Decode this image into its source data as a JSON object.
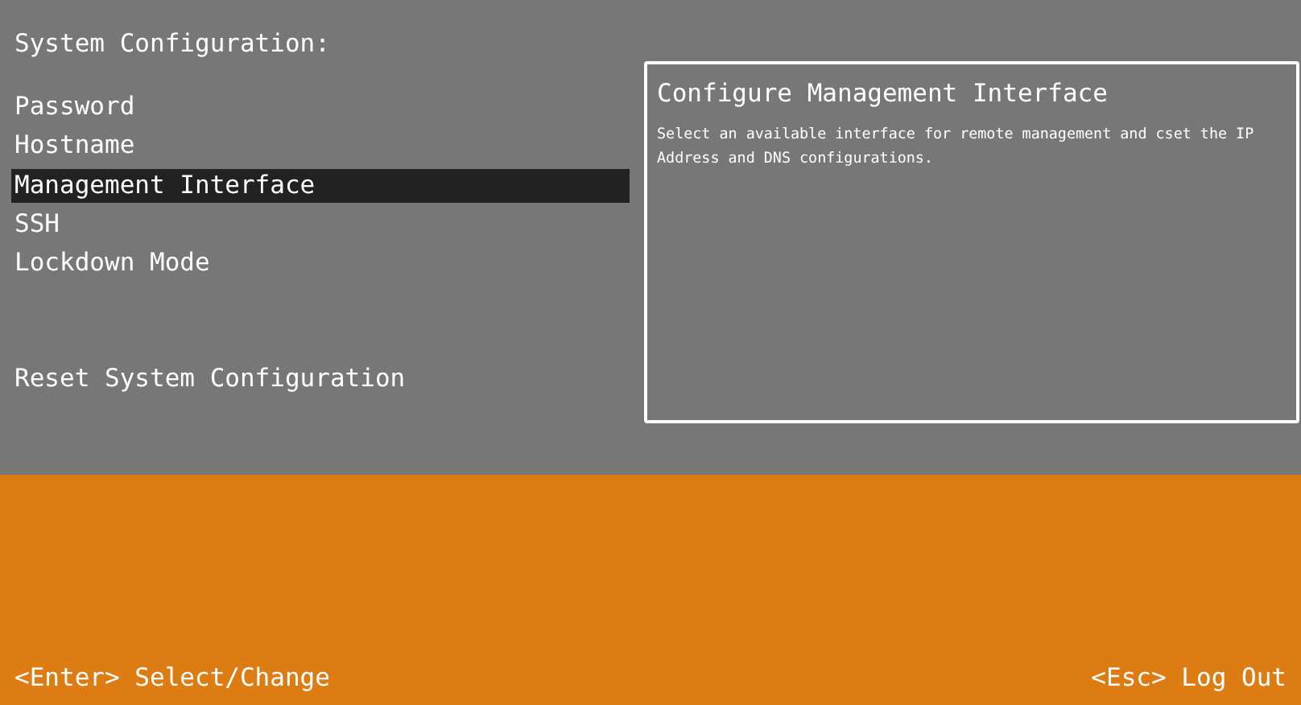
{
  "title": "System Configuration:",
  "menu": [
    {
      "label": "Password",
      "selected": false
    },
    {
      "label": "Hostname",
      "selected": false
    },
    {
      "label": "Management Interface",
      "selected": true
    },
    {
      "label": "SSH",
      "selected": false
    },
    {
      "label": "Lockdown Mode",
      "selected": false
    }
  ],
  "reset_item": {
    "label": "Reset System Configuration",
    "selected": false
  },
  "panel": {
    "title": "Configure Management Interface",
    "description": "Select an available interface for remote management and cset the IP Address and DNS configurations."
  },
  "footer": {
    "left": "<Enter> Select/Change",
    "right": "<Esc> Log Out"
  }
}
